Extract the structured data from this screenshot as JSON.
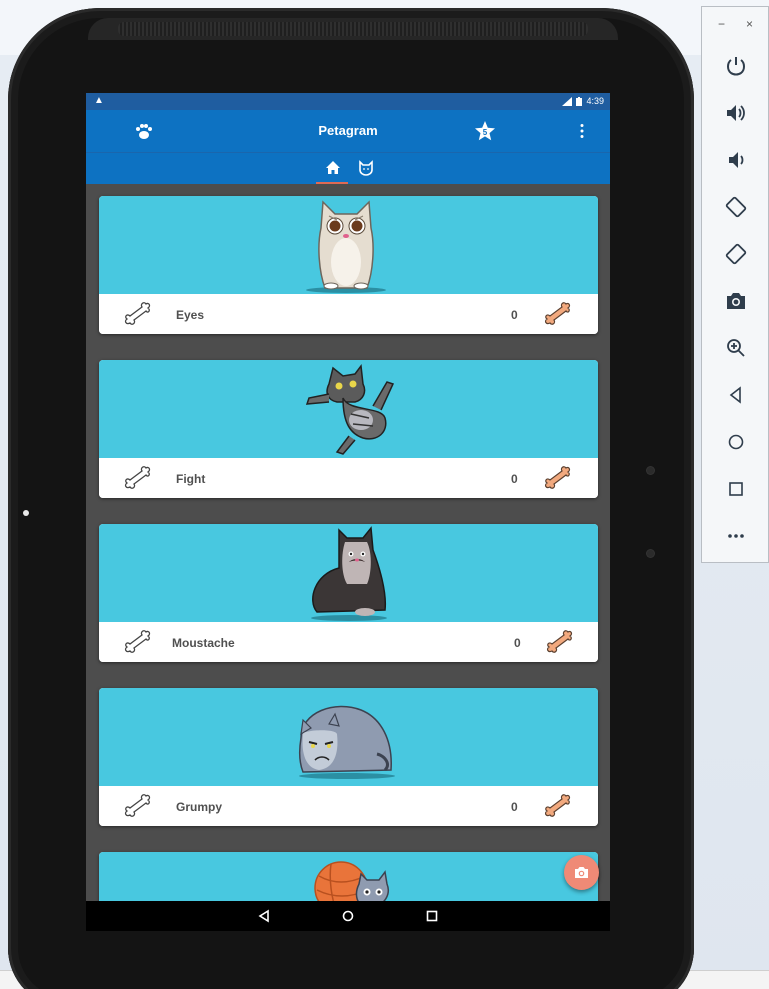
{
  "app": {
    "title": "Petagram",
    "status_time": "4:39",
    "status_warning": "▲",
    "star_badge": "5"
  },
  "tabs": [
    {
      "icon": "home-icon",
      "selected": true
    },
    {
      "icon": "cat-face-icon",
      "selected": false
    }
  ],
  "pets": [
    {
      "name": "Eyes",
      "likes": "0"
    },
    {
      "name": "Fight",
      "likes": "0"
    },
    {
      "name": "Moustache",
      "likes": "0"
    },
    {
      "name": "Grumpy",
      "likes": "0"
    },
    {
      "name": "",
      "likes": ""
    }
  ],
  "colors": {
    "appbar": "#0d72c2",
    "statusbar": "#1f5da0",
    "card_image_bg": "#48c8e0",
    "fab": "#ef8a76",
    "bone_liked": "#f2a97e",
    "list_bg": "#4d4d4d"
  },
  "emulator_panel": {
    "minimize": "−",
    "close": "×",
    "buttons": [
      "power-icon",
      "volume-up-icon",
      "volume-down-icon",
      "rotate-left-icon",
      "rotate-right-icon",
      "screenshot-icon",
      "zoom-icon",
      "back-icon",
      "home-icon",
      "overview-icon",
      "more-icon"
    ]
  }
}
